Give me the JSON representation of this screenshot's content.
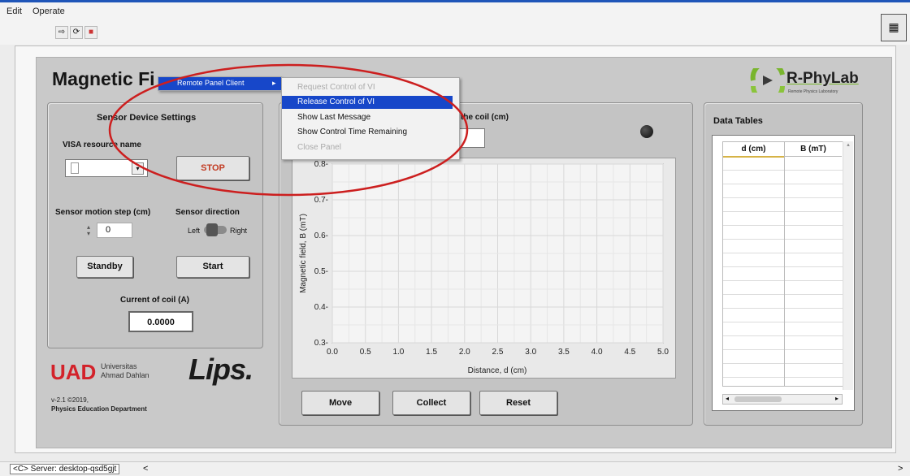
{
  "menubar": {
    "edit": "Edit",
    "operate": "Operate"
  },
  "toolbar": {
    "icons": [
      "run-arrow-icon",
      "run-continuous-icon",
      "abort-stop-icon"
    ]
  },
  "title": "Magnetic Fields of Coils Experiment",
  "title_visible": "Magnetic Fi",
  "logo": {
    "text": "R-PhyLab",
    "sub": "Remote Physics Laboratory"
  },
  "sensor": {
    "title": "Sensor Device Settings",
    "visa_label": "VISA resource name",
    "visa_value": "",
    "stop": "STOP",
    "step_label": "Sensor motion step (cm)",
    "step_value": "0",
    "direction_label": "Sensor direction",
    "dir_left": "Left",
    "dir_right": "Right",
    "standby": "Standby",
    "start": "Start",
    "current_label": "Current of coil (A)",
    "current_value": "0.0000"
  },
  "context_menu": {
    "parent": "Remote Panel Client",
    "items": [
      {
        "label": "Request Control of VI",
        "state": "disabled"
      },
      {
        "label": "Release Control of VI",
        "state": "highlighted"
      },
      {
        "label": "Show Last Message",
        "state": "normal"
      },
      {
        "label": "Show Control Time Remaining",
        "state": "normal"
      },
      {
        "label": "Close Panel",
        "state": "disabled"
      }
    ]
  },
  "graph_panel": {
    "distance_label": "the coil (cm)",
    "distance_value": "",
    "move": "Move",
    "collect": "Collect",
    "reset": "Reset"
  },
  "chart_data": {
    "type": "line",
    "title": "",
    "xlabel": "Distance, d (cm)",
    "ylabel": "Magnetic field, B (mT)",
    "xlim": [
      0,
      5
    ],
    "ylim": [
      0.3,
      0.8
    ],
    "xticks": [
      "0.0",
      "0.5",
      "1.0",
      "1.5",
      "2.0",
      "2.5",
      "3.0",
      "3.5",
      "4.0",
      "4.5",
      "5.0"
    ],
    "yticks": [
      "0.3",
      "0.4",
      "0.5",
      "0.6",
      "0.7",
      "0.8"
    ],
    "grid": true,
    "series": []
  },
  "data_tables": {
    "title": "Data Tables",
    "columns": [
      "d (cm)",
      "B (mT)"
    ]
  },
  "footer": {
    "univ_short": "UAD",
    "univ_line1": "Universitas",
    "univ_line2": "Ahmad Dahlan",
    "lips": "Lips.",
    "version": "v-2.1 ©2019,",
    "dept": "Physics Education Department"
  },
  "statusbar": {
    "server": "<C> Server: desktop-qsd5gjt",
    "arrow": "<",
    "right_arrow": ">"
  },
  "colors": {
    "highlight": "#1747c9",
    "red_oval": "#cc1f1f",
    "uad_red": "#d3222a",
    "logo_green": "#79b52d"
  }
}
